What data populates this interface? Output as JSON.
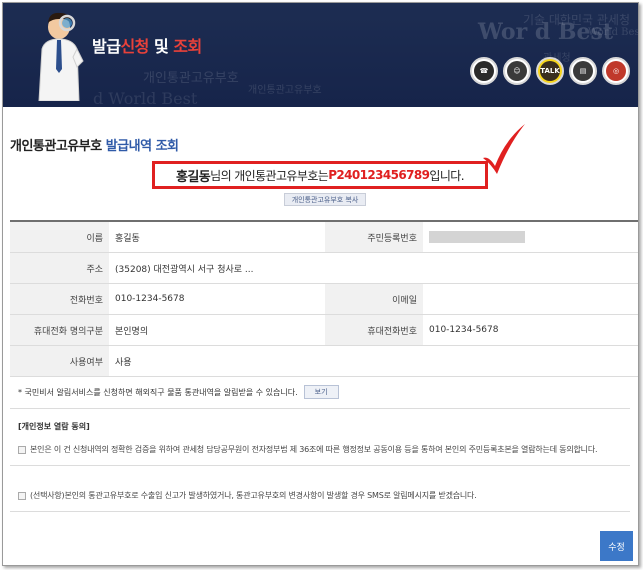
{
  "banner": {
    "title_pre": "발급",
    "title_red1": "신청",
    "title_mid": " 및 ",
    "title_red2": "조회",
    "bg_text": [
      "기술 대한민국 관세청",
      "Wor d Best",
      "World Best 관세청",
      "개인통관고유부호",
      "개인통관고유부호",
      "d World Best",
      "관세청"
    ],
    "icons": [
      {
        "name": "phone-icon",
        "label": "☎",
        "color": "#2b2b2b"
      },
      {
        "name": "person-help-icon",
        "label": "☺",
        "color": "#3a3a3a"
      },
      {
        "name": "kakao-talk-icon",
        "label": "TALK",
        "color": "#3a2e20"
      },
      {
        "name": "monitor-icon",
        "label": "▤",
        "color": "#3a3a3a"
      },
      {
        "name": "government-emblem-icon",
        "label": "◎",
        "color": "#c0392b"
      }
    ]
  },
  "page": {
    "title_black": "개인통관고유부호 ",
    "title_blue": "발급내역 조회"
  },
  "result": {
    "name": "홍길동",
    "middle": " 님의 개인통관고유부호는",
    "number": "P240123456789",
    "suffix": " 입니다."
  },
  "copy_button": "개인통관고유부호 복사",
  "table": {
    "name_label": "이름",
    "name_value": "홍길동",
    "rrn_label": "주민등록번호",
    "address_label": "주소",
    "address_value": "(35208)  대전광역시 서구 청사로 ...",
    "phone_label": "전화번호",
    "phone_value": "010-1234-5678",
    "email_label": "이메일",
    "email_value": "",
    "mobile_type_label": "휴대전화 명의구분",
    "mobile_type_value": "본인명의",
    "mobile_label": "휴대전화번호",
    "mobile_value": "010-1234-5678",
    "status_label": "사용여부",
    "status_value": "사용"
  },
  "notice": {
    "text": "* 국민비서 알림서비스를 신청하면 해외직구 물품 통관내역을 알림받을 수 있습니다.",
    "button": "보기"
  },
  "consent": {
    "title": "[개인정보 열람 동의]",
    "item1": "본인은 이 건 신청내역의 정확한 검증을 위하여 관세청 담당공무원이 전자정부법 제 36조에 따른 행정정보 공동이용 등을 통하여 본인의 주민등록초본을 열람하는데 동의합니다.",
    "item2": "(선택사항)본인의 통관고유부호로 수출입 신고가 발생하였거나, 통관고유부호의 변경사항이 발생할 경우 SMS로 알림메시지를 받겠습니다."
  },
  "submit_button": "수정"
}
